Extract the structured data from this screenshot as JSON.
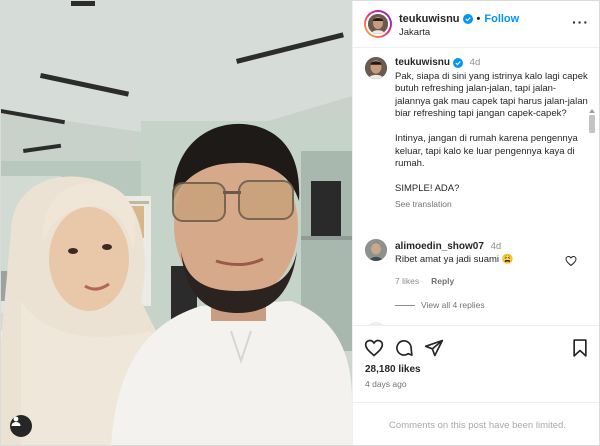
{
  "post": {
    "username": "teukuwisnu",
    "follow_label": "Follow",
    "location": "Jakarta",
    "separator": "•"
  },
  "caption": {
    "username": "teukuwisnu",
    "time": "4d",
    "paragraph1": "Pak, siapa di sini yang istrinya kalo lagi capek butuh refreshing jalan-jalan, tapi jalan-jalannya gak mau capek tapi harus jalan-jalan biar refreshing tapi jangan capek-capek?",
    "paragraph2": "Intinya, jangan di rumah karena pengennya keluar, tapi kalo ke luar pengennya kaya di rumah.",
    "paragraph3": "SIMPLE! ADA?",
    "see_translation": "See translation"
  },
  "comment": {
    "username": "alimoedin_show07",
    "time": "4d",
    "text": "Ribet amat ya jadi suami 😩",
    "likes": "7 likes",
    "reply": "Reply",
    "view_replies": "View all 4 replies"
  },
  "footer": {
    "likes": "28,180 likes",
    "ago": "4 days ago",
    "limited": "Comments on this post have been limited."
  },
  "icons": {
    "more": "more-options-icon",
    "verified": "verified-badge-icon",
    "like": "heart-icon",
    "comment": "comment-icon",
    "share": "share-icon",
    "save": "bookmark-icon",
    "tag": "person-tag-icon"
  },
  "colors": {
    "accent": "#0095f6",
    "text": "#262626",
    "muted": "#737373"
  }
}
